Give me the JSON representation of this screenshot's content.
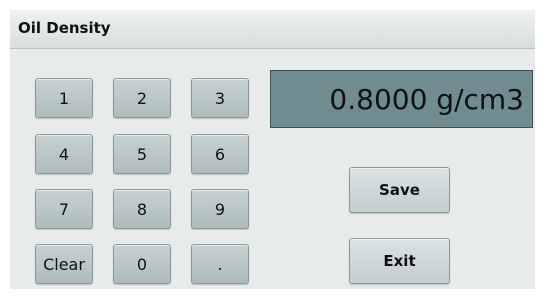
{
  "window": {
    "title": "Oil Density"
  },
  "display": {
    "value": "0.8000 g/cm3"
  },
  "keypad": {
    "keys": [
      "1",
      "2",
      "3",
      "4",
      "5",
      "6",
      "7",
      "8",
      "9",
      "Clear",
      "0",
      "."
    ]
  },
  "actions": {
    "save_label": "Save",
    "exit_label": "Exit"
  },
  "colors": {
    "display_background": "#6f8d91",
    "key_background": "#b9c6c7",
    "panel_background": "#e7eceb"
  }
}
